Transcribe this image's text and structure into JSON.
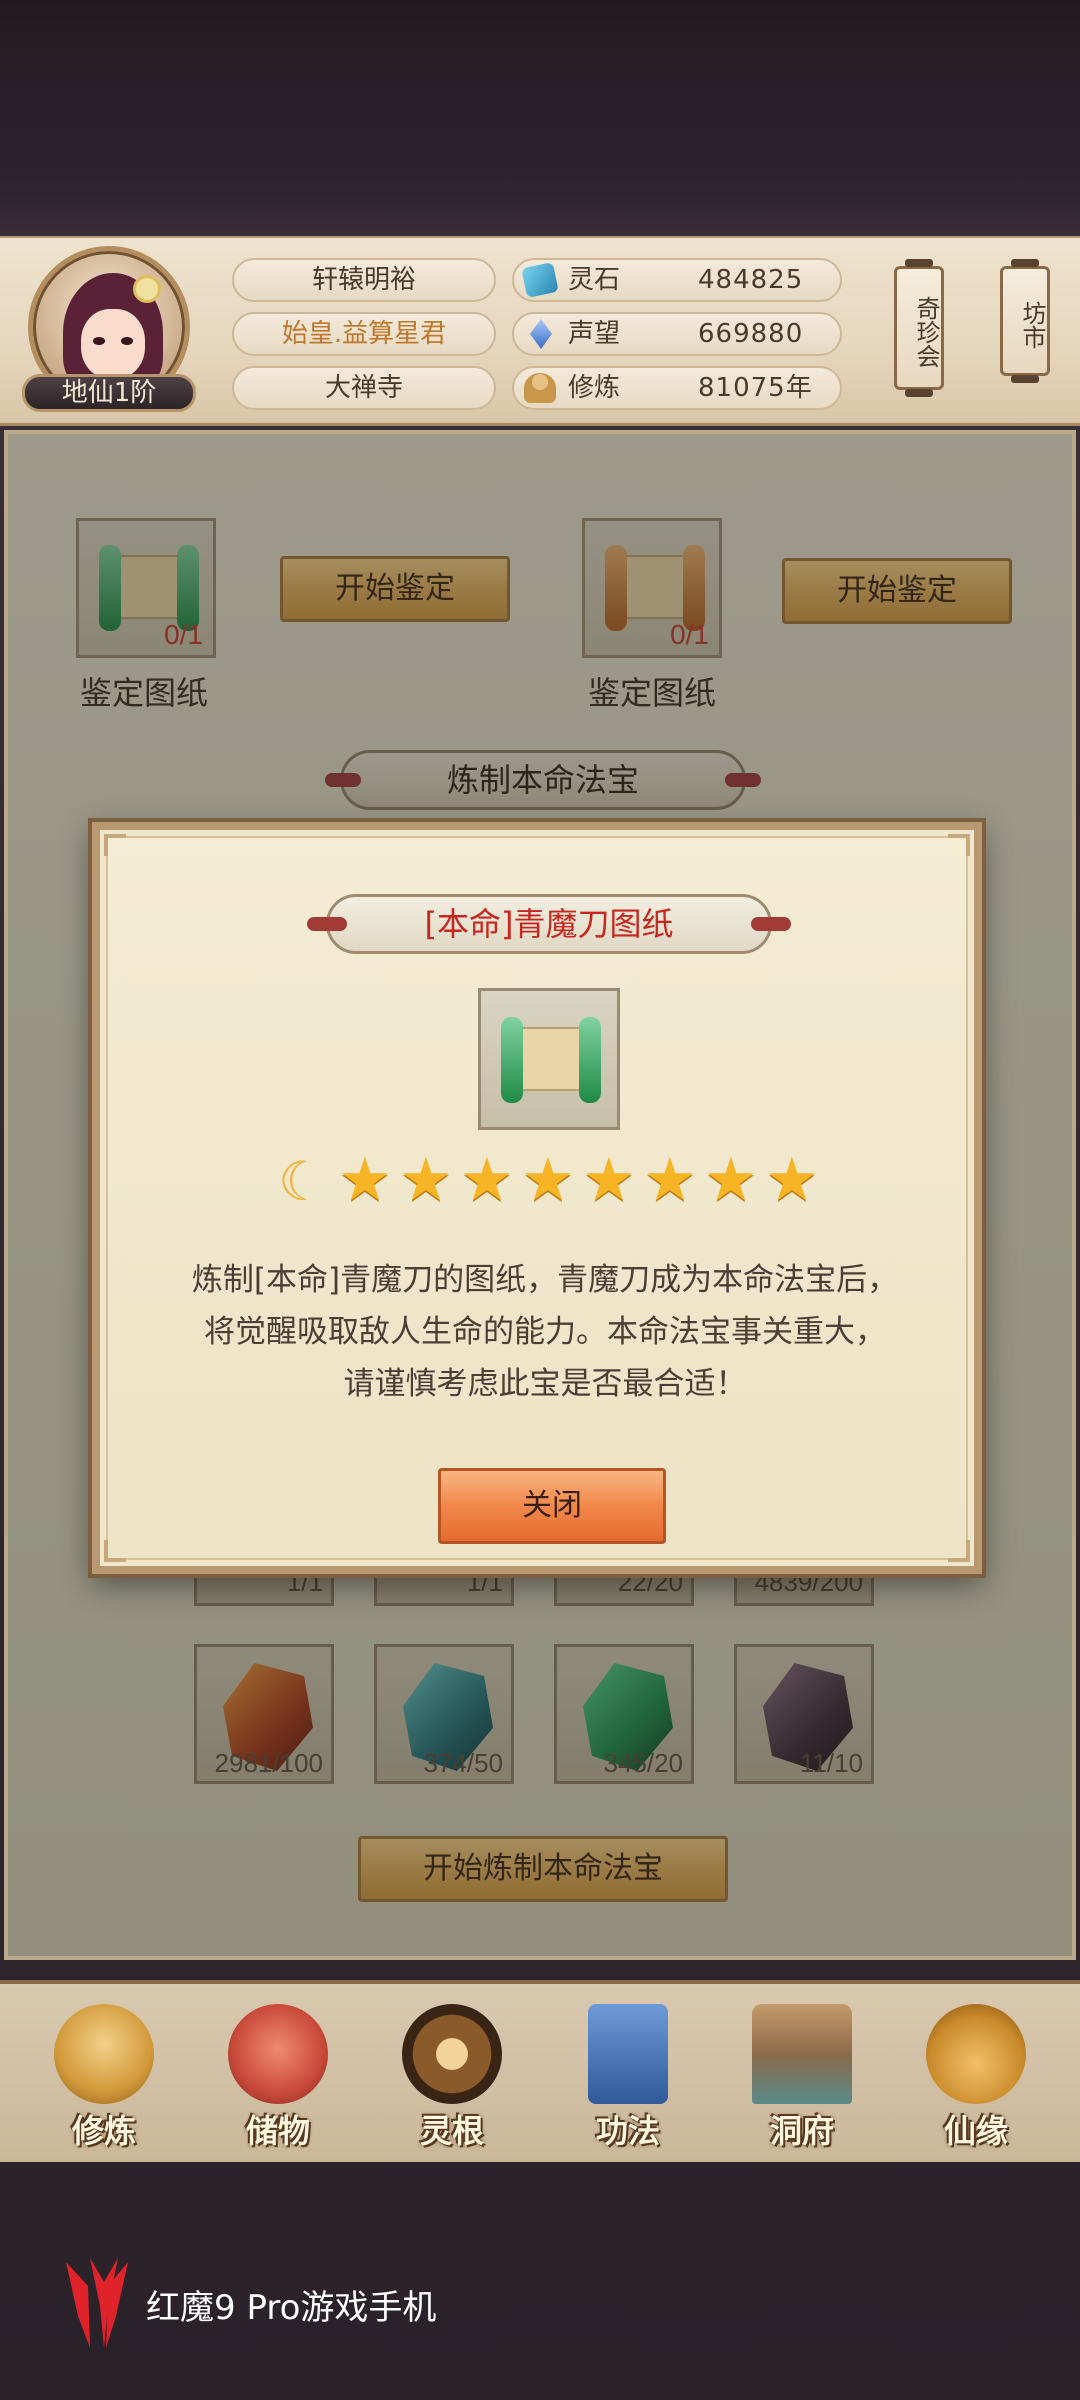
{
  "player": {
    "name": "轩辕明裕",
    "title": "始皇.益算星君",
    "sect": "大禅寺",
    "rank": "地仙1阶"
  },
  "resources": [
    {
      "label": "灵石",
      "value": "484825",
      "icon": "spirit-stone-icon",
      "color": "#3aa0c8"
    },
    {
      "label": "声望",
      "value": "669880",
      "icon": "prestige-crystal-icon",
      "color": "#5a8ad8"
    },
    {
      "label": "修炼",
      "value": "81075年",
      "icon": "meditation-icon",
      "color": "#c9974a"
    }
  ],
  "side_buttons": {
    "treasure_fair": "奇珍会",
    "market": "坊市"
  },
  "appraise": {
    "items": [
      {
        "label": "鉴定图纸",
        "count": "0/1",
        "button": "开始鉴定",
        "roll_color": "#2f9a4a"
      },
      {
        "label": "鉴定图纸",
        "count": "0/1",
        "button": "开始鉴定",
        "roll_color": "#c7772a"
      }
    ]
  },
  "forge": {
    "banner": "炼制本命法宝",
    "row1_counts": [
      "1/1",
      "1/1",
      "22/20",
      "4839/200"
    ],
    "materials": [
      {
        "count": "2981/100",
        "color": "#c1582a"
      },
      {
        "count": "374/50",
        "color": "#2c7f86"
      },
      {
        "count": "345/20",
        "color": "#1f8a4e"
      },
      {
        "count": "11/10",
        "color": "#4a3a48"
      }
    ],
    "start_button": "开始炼制本命法宝"
  },
  "modal": {
    "title": "[本命]青魔刀图纸",
    "moon": "☾",
    "stars": 8,
    "description_lines": [
      "炼制[本命]青魔刀的图纸，青魔刀成为本命法宝后，",
      "将觉醒吸取敌人生命的能力。本命法宝事关重大，",
      "请谨慎考虑此宝是否最合适！"
    ],
    "close_button": "关闭"
  },
  "bottom_nav": [
    {
      "label": "修炼",
      "icon": "cultivate-icon",
      "color": "#d29a3a"
    },
    {
      "label": "储物",
      "icon": "storage-bag-icon",
      "color": "#c94a3a"
    },
    {
      "label": "灵根",
      "icon": "spirit-root-icon",
      "color": "#8a5a2a"
    },
    {
      "label": "功法",
      "icon": "technique-book-icon",
      "color": "#3a6aa8"
    },
    {
      "label": "洞府",
      "icon": "cave-dwelling-icon",
      "color": "#8c6a4a"
    },
    {
      "label": "仙缘",
      "icon": "gourd-icon",
      "color": "#c98a2a"
    }
  ],
  "device_brand": "红魔9 Pro游戏手机",
  "colors": {
    "accent_red": "#c7271f",
    "gold_button": "#e0ae5c",
    "close_orange": "#f2884a"
  }
}
